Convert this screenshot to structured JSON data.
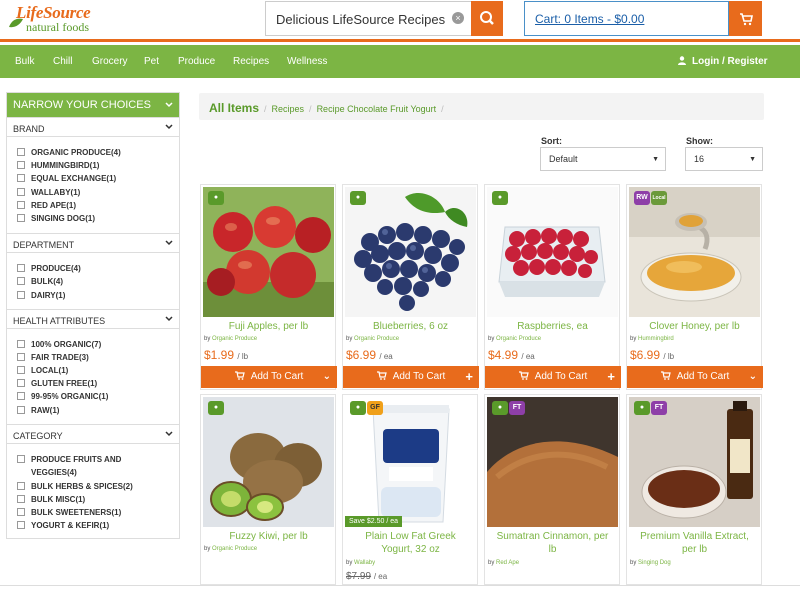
{
  "header": {
    "logo_top": "LifeSource",
    "logo_bottom": "natural foods",
    "search_value": "Delicious LifeSource Recipes",
    "cart_label": "Cart: 0 Items - $0.00"
  },
  "nav": {
    "items": [
      "Bulk",
      "Chill",
      "Grocery",
      "Pet",
      "Produce",
      "Recipes",
      "Wellness"
    ],
    "login": "Login / Register"
  },
  "sidebar": {
    "title": "NARROW YOUR CHOICES",
    "sections": [
      {
        "title": "BRAND",
        "options": [
          "ORGANIC PRODUCE(4)",
          "HUMMINGBIRD(1)",
          "EQUAL EXCHANGE(1)",
          "WALLABY(1)",
          "RED APE(1)",
          "SINGING DOG(1)"
        ]
      },
      {
        "title": "DEPARTMENT",
        "options": [
          "PRODUCE(4)",
          "BULK(4)",
          "DAIRY(1)"
        ]
      },
      {
        "title": "HEALTH ATTRIBUTES",
        "options": [
          "100% ORGANIC(7)",
          "FAIR TRADE(3)",
          "LOCAL(1)",
          "GLUTEN FREE(1)",
          "99-95% ORGANIC(1)",
          "RAW(1)"
        ]
      },
      {
        "title": "CATEGORY",
        "options": [
          "PRODUCE FRUITS AND",
          "VEGGIES(4)",
          "BULK HERBS & SPICES(2)",
          "BULK MISC(1)",
          "BULK SWEETENERS(1)",
          "YOGURT & KEFIR(1)"
        ]
      }
    ]
  },
  "breadcrumb": {
    "all": "All Items",
    "items": [
      "Recipes",
      "Recipe Chocolate Fruit Yogurt"
    ]
  },
  "controls": {
    "sort_label": "Sort:",
    "sort_value": "Default",
    "show_label": "Show:",
    "show_value": "16"
  },
  "products": [
    {
      "title": "Fuji Apples, per lb",
      "by": "Organic Produce",
      "price": "$1.99",
      "unit": "/ lb",
      "badges": [
        "organic"
      ]
    },
    {
      "title": "Blueberries, 6 oz",
      "by": "Organic Produce",
      "price": "$6.99",
      "unit": "/ ea",
      "badges": [
        "organic"
      ]
    },
    {
      "title": "Raspberries, ea",
      "by": "Organic Produce",
      "price": "$4.99",
      "unit": "/ ea",
      "badges": [
        "organic"
      ]
    },
    {
      "title": "Clover Honey, per lb",
      "by": "Hummingbird",
      "price": "$6.99",
      "unit": "/ lb",
      "badges": [
        "RW",
        "local"
      ]
    },
    {
      "title": "Fuzzy Kiwi, per lb",
      "by": "Organic Produce",
      "price": "",
      "unit": "",
      "badges": [
        "organic"
      ]
    },
    {
      "title_line1": "Plain Low Fat Greek",
      "title_line2": "Yogurt, 32 oz",
      "by": "Wallaby",
      "price": "$7.99",
      "unit": "/ ea",
      "save": "Save $2.50 / ea",
      "badges": [
        "organic",
        "GF"
      ]
    },
    {
      "title_line1": "Sumatran Cinnamon, per",
      "title_line2": "lb",
      "by": "Red Ape",
      "price": "",
      "unit": "",
      "badges": [
        "organic",
        "FT"
      ]
    },
    {
      "title_line1": "Premium Vanilla Extract,",
      "title_line2": "per lb",
      "by": "Singing Dog",
      "price": "",
      "unit": "",
      "badges": [
        "organic",
        "FT"
      ]
    }
  ],
  "labels": {
    "add_to_cart": "Add To Cart",
    "by_prefix": "by"
  },
  "colors": {
    "accent": "#e86b1c",
    "brand_green": "#7cb544"
  }
}
